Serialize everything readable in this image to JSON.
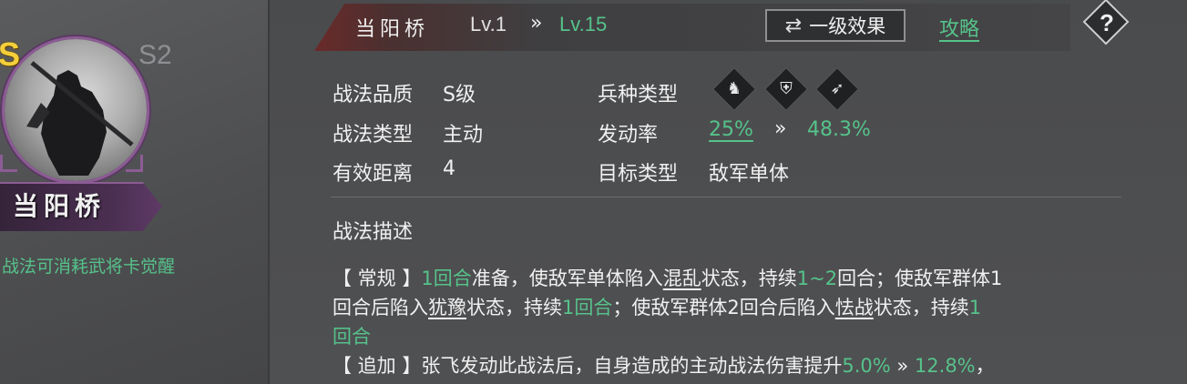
{
  "card": {
    "quality_badge": "S",
    "season": "S2",
    "name": "当阳桥",
    "awaken_note": "战法可消耗武将卡觉醒"
  },
  "header": {
    "name": "当阳桥",
    "level_from": "Lv.1",
    "arrow": "»",
    "level_to": "Lv.15",
    "effect_button": "一级效果",
    "swap_icon": "⇄",
    "guide_link": "攻略",
    "help": "?"
  },
  "stats": {
    "quality_label": "战法品质",
    "quality_value": "S级",
    "type_label": "战法类型",
    "type_value": "主动",
    "range_label": "有效距离",
    "range_value": "4",
    "unit_label": "兵种类型",
    "units": [
      "cavalry-icon",
      "shield-icon",
      "bow-icon"
    ],
    "rate_label": "发动率",
    "rate_from": "25%",
    "rate_arrow": "»",
    "rate_to": "48.3%",
    "target_label": "目标类型",
    "target_value": "敌军单体"
  },
  "description": {
    "title": "战法描述",
    "l1": [
      "【 常规 】",
      "1回合",
      "准备，使敌军单体陷入",
      "混乱",
      "状态，持续",
      "1~2",
      "回合；使敌军群体1"
    ],
    "l2": [
      "回合后陷入",
      "犹豫",
      "状态，持续",
      "1回合",
      "；使敌军群体2回合后陷入",
      "怯战",
      "状态，持续",
      "1"
    ],
    "l3": [
      "回合"
    ],
    "l4": [
      "【 追加 】张飞发动此战法后，自身造成的主动战法伤害提升",
      "5.0%",
      " » ",
      "12.8%",
      "，"
    ]
  },
  "colors": {
    "accent_green": "#56c28a",
    "quality_gold": "#f4cf3a",
    "frame_purple": "#8c5c94"
  }
}
